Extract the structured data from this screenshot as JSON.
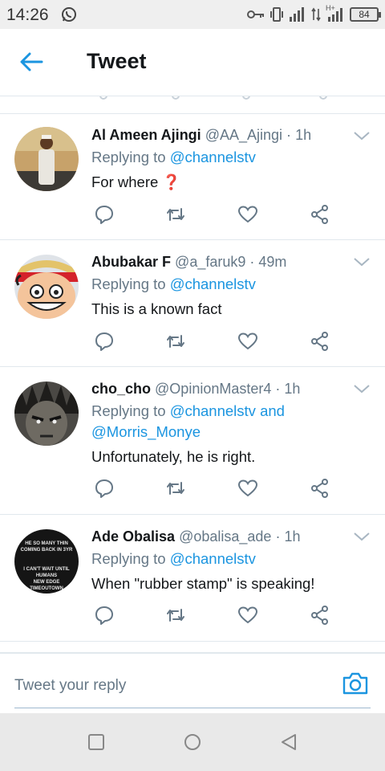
{
  "status_bar": {
    "time": "14:26",
    "battery": "84",
    "network": "H+"
  },
  "header": {
    "title": "Tweet"
  },
  "tweets": [
    {
      "name": "Al Ameen Ajingi",
      "handle": "@AA_Ajingi",
      "time": "1h",
      "replying_prefix": "Replying to",
      "mentions": [
        "@channelstv"
      ],
      "mention_joiner": "",
      "text": "For where",
      "emoji": "❓"
    },
    {
      "name": "Abubakar F",
      "handle": "@a_faruk9",
      "time": "49m",
      "replying_prefix": "Replying to",
      "mentions": [
        "@channelstv"
      ],
      "mention_joiner": "",
      "text": "This is a known fact"
    },
    {
      "name": "cho_cho",
      "handle": "@OpinionMaster4",
      "time": "1h",
      "replying_prefix": "Replying to",
      "mentions": [
        "@channelstv",
        "@Morris_Monye"
      ],
      "mention_joiner": "and",
      "text": "Unfortunately, he is right."
    },
    {
      "name": "Ade Obalisa",
      "handle": "@obalisa_ade",
      "time": "1h",
      "replying_prefix": "Replying to",
      "mentions": [
        "@channelstv"
      ],
      "mention_joiner": "",
      "text": "When \"rubber stamp\" is speaking!",
      "avatar_text": [
        "HE SO MANY THIN",
        "COMING BACK IN 3YR",
        "I CAN'T WAIT UNTIL HUMANS",
        "NEW EDGE",
        "TIMEOUTOWN"
      ]
    }
  ],
  "reply": {
    "placeholder": "Tweet your reply"
  },
  "colors": {
    "accent": "#1b95e0",
    "secondary_text": "#657786",
    "divider": "#e1e8ed",
    "emoji_red": "#d0021b"
  },
  "icons": [
    "back-arrow-icon",
    "chevron-down-icon",
    "reply-icon",
    "retweet-icon",
    "like-icon",
    "share-icon",
    "camera-icon"
  ]
}
